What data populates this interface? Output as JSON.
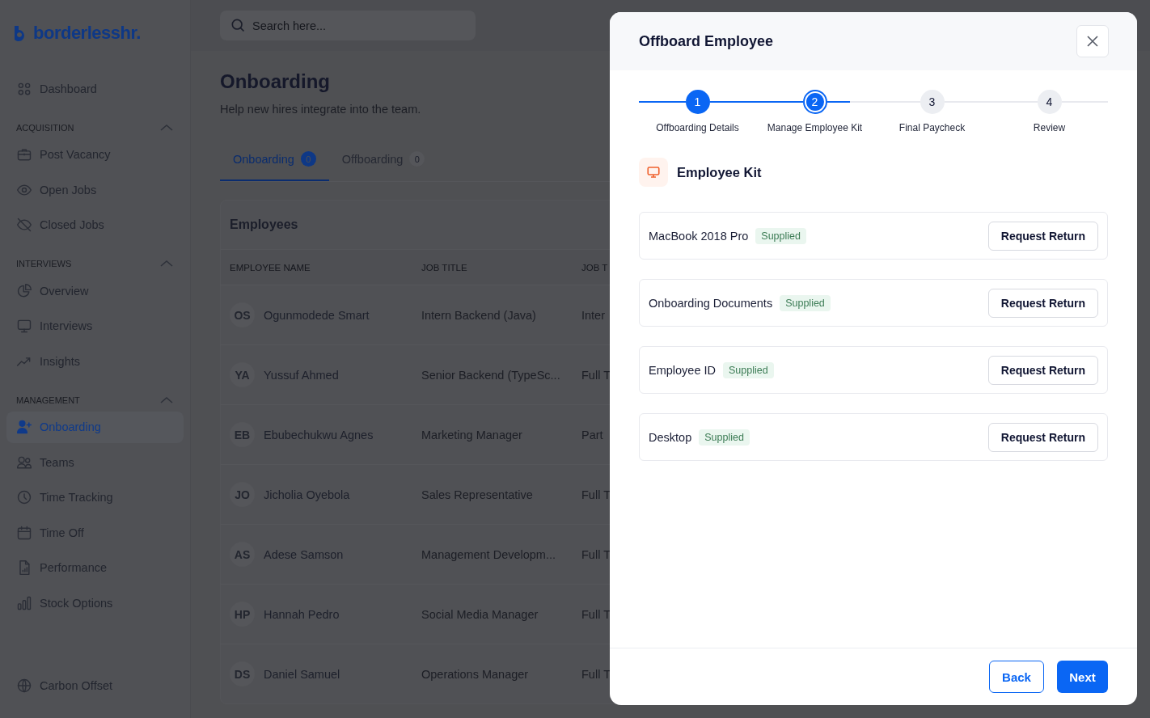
{
  "sidebar": {
    "logo": "borderlesshr.",
    "top_items": [
      {
        "label": "Dashboard",
        "selected": false
      }
    ],
    "sections": [
      {
        "title": "ACQUISITION",
        "expanded": true,
        "items": [
          {
            "label": "Post Vacancy",
            "selected": false
          },
          {
            "label": "Open Jobs",
            "selected": false
          },
          {
            "label": "Closed Jobs",
            "selected": false
          }
        ]
      },
      {
        "title": "INTERVIEWS",
        "expanded": true,
        "items": [
          {
            "label": "Overview",
            "selected": false
          },
          {
            "label": "Interviews",
            "selected": false
          },
          {
            "label": "Insights",
            "selected": false
          }
        ]
      },
      {
        "title": "MANAGEMENT",
        "expanded": true,
        "items": [
          {
            "label": "Onboarding",
            "selected": true
          },
          {
            "label": "Teams",
            "selected": false
          },
          {
            "label": "Time Tracking",
            "selected": false
          },
          {
            "label": "Time Off",
            "selected": false
          },
          {
            "label": "Performance",
            "selected": false
          },
          {
            "label": "Stock Options",
            "selected": false
          }
        ]
      }
    ],
    "bottom_items": [
      {
        "label": "Carbon Offset",
        "selected": false
      }
    ]
  },
  "search": {
    "placeholder": "Search here..."
  },
  "page": {
    "title": "Onboarding",
    "subtitle": "Help new hires integrate into the team."
  },
  "tabs": [
    {
      "label": "Onboarding",
      "count": "0",
      "selected": true
    },
    {
      "label": "Offboarding",
      "count": "0",
      "selected": false
    }
  ],
  "table": {
    "title": "Employees",
    "columns": [
      "EMPLOYEE NAME",
      "JOB TITLE",
      "JOB T"
    ],
    "rows": [
      {
        "initials": "OS",
        "name": "Ogunmodede Smart",
        "job_title": "Intern Backend (Java)",
        "column_3": "Inter"
      },
      {
        "initials": "YA",
        "name": "Yussuf Ahmed",
        "job_title": "Senior Backend (TypeSc...",
        "column_3": "Full T"
      },
      {
        "initials": "EB",
        "name": "Ebubechukwu Agnes",
        "job_title": "Marketing Manager",
        "column_3": "Part"
      },
      {
        "initials": "JO",
        "name": "Jicholia Oyebola",
        "job_title": "Sales Representative",
        "column_3": "Full T"
      },
      {
        "initials": "AS",
        "name": "Adese Samson",
        "job_title": "Management Developm...",
        "column_3": "Full T"
      },
      {
        "initials": "HP",
        "name": "Hannah Pedro",
        "job_title": "Social Media Manager",
        "column_3": "Full T"
      },
      {
        "initials": "DS",
        "name": "Daniel Samuel",
        "job_title": "Operations Manager",
        "column_3": "Full T"
      }
    ]
  },
  "modal": {
    "title": "Offboard Employee",
    "steps": [
      {
        "number": "1",
        "label": "Offboarding Details",
        "done": true,
        "selected": false
      },
      {
        "number": "2",
        "label": "Manage Employee Kit",
        "done": false,
        "selected": true
      },
      {
        "number": "3",
        "label": "Final Paycheck",
        "done": false,
        "selected": false
      },
      {
        "number": "4",
        "label": "Review",
        "done": false,
        "selected": false
      }
    ],
    "section_title": "Employee Kit",
    "kit_items": [
      {
        "name": "MacBook 2018 Pro",
        "status": "Supplied",
        "action": "Request Return"
      },
      {
        "name": "Onboarding Documents",
        "status": "Supplied",
        "action": "Request Return"
      },
      {
        "name": "Employee ID",
        "status": "Supplied",
        "action": "Request Return"
      },
      {
        "name": "Desktop",
        "status": "Supplied",
        "action": "Request Return"
      }
    ],
    "buttons": {
      "back": "Back",
      "next": "Next"
    }
  }
}
